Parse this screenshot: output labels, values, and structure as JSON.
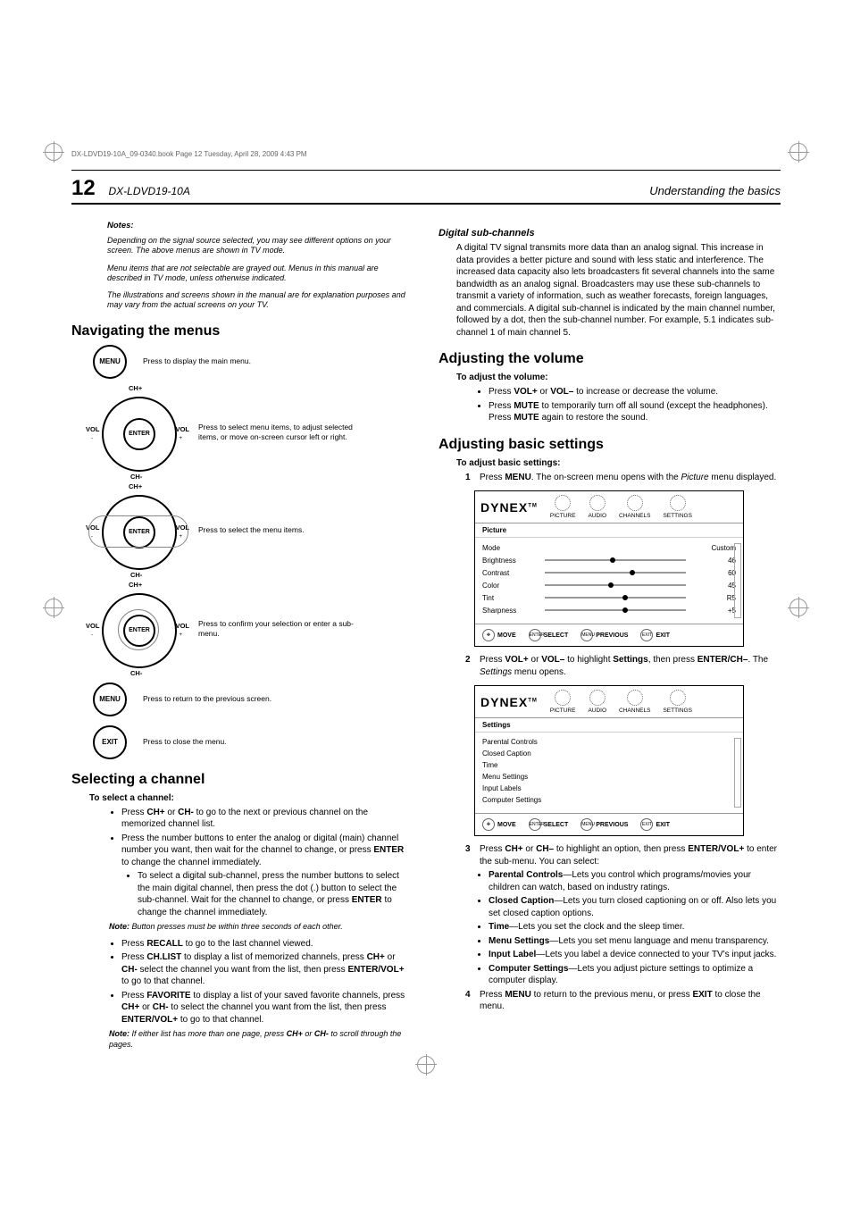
{
  "print_header": "DX-LDVD19-10A_09-0340.book  Page 12  Tuesday, April 28, 2009  4:43 PM",
  "page_number": "12",
  "model": "DX-LDVD19-10A",
  "running_head": "Understanding the basics",
  "left": {
    "notes_head": "Notes:",
    "note1": "Depending on the signal source selected, you may see different options on your screen. The above menus are shown in TV mode.",
    "note2": "Menu items that are not selectable are grayed out. Menus in this manual are described in TV mode, unless otherwise indicated.",
    "note3": "The illustrations and screens shown in the manual are for explanation purposes and may vary from the actual screens on your TV.",
    "nav_heading": "Navigating the menus",
    "remote": {
      "menu_btn": "MENU",
      "desc_menu": "Press to display the main menu.",
      "ch_plus": "CH+",
      "ch_minus": "CH-",
      "vol_minus": "VOL",
      "vol_minus_sub": "-",
      "vol_plus": "VOL",
      "vol_plus_sub": "+",
      "enter": "ENTER",
      "desc_arrows": "Press to select menu items, to adjust selected items, or move on-screen cursor left or right.",
      "desc_select": "Press to select the menu items.",
      "desc_confirm": "Press to confirm your selection or enter a sub-menu.",
      "desc_return": "Press to return to the previous screen.",
      "exit_btn": "EXIT",
      "desc_exit": "Press to close the menu."
    },
    "sel_heading": "Selecting a channel",
    "sel_proc": "To select a channel:",
    "sel_b1a": "Press ",
    "sel_b1b": "CH+",
    "sel_b1c": " or ",
    "sel_b1d": "CH-",
    "sel_b1e": " to go to the next or previous channel on the memorized channel list.",
    "sel_b2a": "Press the number buttons to enter the analog or digital (main) channel number you want, then wait for the channel to change, or press ",
    "sel_b2b": "ENTER",
    "sel_b2c": " to change the channel immediately.",
    "sel_b2_sub_a": "To select a digital sub-channel, press the number buttons to select the main digital channel, then press the dot (.) button to select the sub-channel. Wait for the channel to change, or press ",
    "sel_b2_sub_b": "ENTER",
    "sel_b2_sub_c": " to change the channel immediately.",
    "sel_note1_label": "Note:",
    "sel_note1_body": " Button presses must be within three seconds of each other.",
    "sel_b3a": "Press ",
    "sel_b3b": "RECALL",
    "sel_b3c": " to go to the last channel viewed.",
    "sel_b4a": "Press ",
    "sel_b4b": "CH.LIST",
    "sel_b4c": " to display a list of memorized channels, press ",
    "sel_b4d": "CH+",
    "sel_b4e": " or ",
    "sel_b4f": "CH-",
    "sel_b4g": " select the channel you want from the list, then press ",
    "sel_b4h": "ENTER/VOL+",
    "sel_b4i": " to go to that channel.",
    "sel_b5a": "Press ",
    "sel_b5b": "FAVORITE",
    "sel_b5c": " to display a list of your saved favorite channels, press ",
    "sel_b5d": "CH+",
    "sel_b5e": " or ",
    "sel_b5f": "CH-",
    "sel_b5g": " to select the channel you want from the list, then press ",
    "sel_b5h": "ENTER/VOL+",
    "sel_b5i": " to go to that channel.",
    "sel_note2_label": "Note:",
    "sel_note2_body": " If either list has more than one page, press ",
    "sel_note2_b1": "CH+",
    "sel_note2_mid": " or ",
    "sel_note2_b2": "CH-",
    "sel_note2_end": " to scroll through the pages."
  },
  "right": {
    "dsc_heading": "Digital sub-channels",
    "dsc_para": "A digital TV signal transmits more data than an analog signal. This increase in data provides a better picture and sound with less static and interference. The increased data capacity also lets broadcasters fit several channels into the same bandwidth as an analog signal. Broadcasters may use these sub-channels to transmit a variety of information, such as weather forecasts, foreign languages, and commercials. A digital sub-channel is indicated by the main channel number, followed by a dot, then the sub-channel number. For example, 5.1 indicates sub-channel 1 of main channel 5.",
    "vol_heading": "Adjusting the volume",
    "vol_proc": "To adjust the volume:",
    "vol_b1a": "Press ",
    "vol_b1b": "VOL+",
    "vol_b1c": " or ",
    "vol_b1d": "VOL–",
    "vol_b1e": " to increase or decrease the volume.",
    "vol_b2a": "Press ",
    "vol_b2b": "MUTE",
    "vol_b2c": " to temporarily turn off all sound (except the headphones). Press ",
    "vol_b2d": "MUTE",
    "vol_b2e": " again to restore the sound.",
    "bas_heading": "Adjusting basic settings",
    "bas_proc": "To adjust basic settings:",
    "bas_s1a": "Press ",
    "bas_s1b": "MENU",
    "bas_s1c": ". The on-screen menu opens with the ",
    "bas_s1d": "Picture",
    "bas_s1e": " menu displayed.",
    "osd": {
      "logo": "DYNEX",
      "tm": "TM",
      "tabs": [
        "PICTURE",
        "AUDIO",
        "CHANNELS",
        "SETTINGS"
      ],
      "picture_label": "Picture",
      "rows": [
        {
          "label": "Mode",
          "value": "Custom",
          "knob": null
        },
        {
          "label": "Brightness",
          "value": "46",
          "knob": 46
        },
        {
          "label": "Contrast",
          "value": "60",
          "knob": 60
        },
        {
          "label": "Color",
          "value": "45",
          "knob": 45
        },
        {
          "label": "Tint",
          "value": "R5",
          "knob": 55
        },
        {
          "label": "Sharpness",
          "value": "+5",
          "knob": 55
        }
      ],
      "foot": {
        "move": "MOVE",
        "select_inner": "ENTER",
        "select": "SELECT",
        "prev_inner": "MENU",
        "previous": "PREVIOUS",
        "exit_inner": "EXIT",
        "exit": "EXIT"
      },
      "settings_label": "Settings",
      "settings_items": [
        "Parental Controls",
        "Closed Caption",
        "Time",
        "Menu Settings",
        "Input Labels",
        "Computer Settings"
      ]
    },
    "bas_s2a": "Press ",
    "bas_s2b": "VOL+",
    "bas_s2c": " or ",
    "bas_s2d": "VOL–",
    "bas_s2e": " to highlight ",
    "bas_s2f": "Settings",
    "bas_s2g": ", then press ",
    "bas_s2h": "ENTER/CH–",
    "bas_s2i": ". The ",
    "bas_s2j": "Settings",
    "bas_s2k": " menu opens.",
    "bas_s3a": "Press ",
    "bas_s3b": "CH+",
    "bas_s3c": " or ",
    "bas_s3d": "CH–",
    "bas_s3e": " to highlight an option, then press ",
    "bas_s3f": "ENTER/VOL+",
    "bas_s3g": " to enter the sub-menu. You can select:",
    "opt1_b": "Parental Controls",
    "opt1_t": "—Lets you control which programs/movies your children can watch, based on industry ratings.",
    "opt2_b": "Closed Caption",
    "opt2_t": "—Lets you turn closed captioning on or off. Also lets you set closed caption options.",
    "opt3_b": "Time",
    "opt3_t": "—Lets you set the clock and the sleep timer.",
    "opt4_b": "Menu Settings",
    "opt4_t": "—Lets you set menu language and menu transparency.",
    "opt5_b": "Input Label",
    "opt5_t": "—Lets you label a device connected to your TV's input jacks.",
    "opt6_b": "Computer Settings",
    "opt6_t": "—Lets you adjust picture settings to optimize a computer display.",
    "bas_s4a": "Press ",
    "bas_s4b": "MENU",
    "bas_s4c": " to return to the previous menu, or press ",
    "bas_s4d": "EXIT",
    "bas_s4e": " to close the menu."
  }
}
